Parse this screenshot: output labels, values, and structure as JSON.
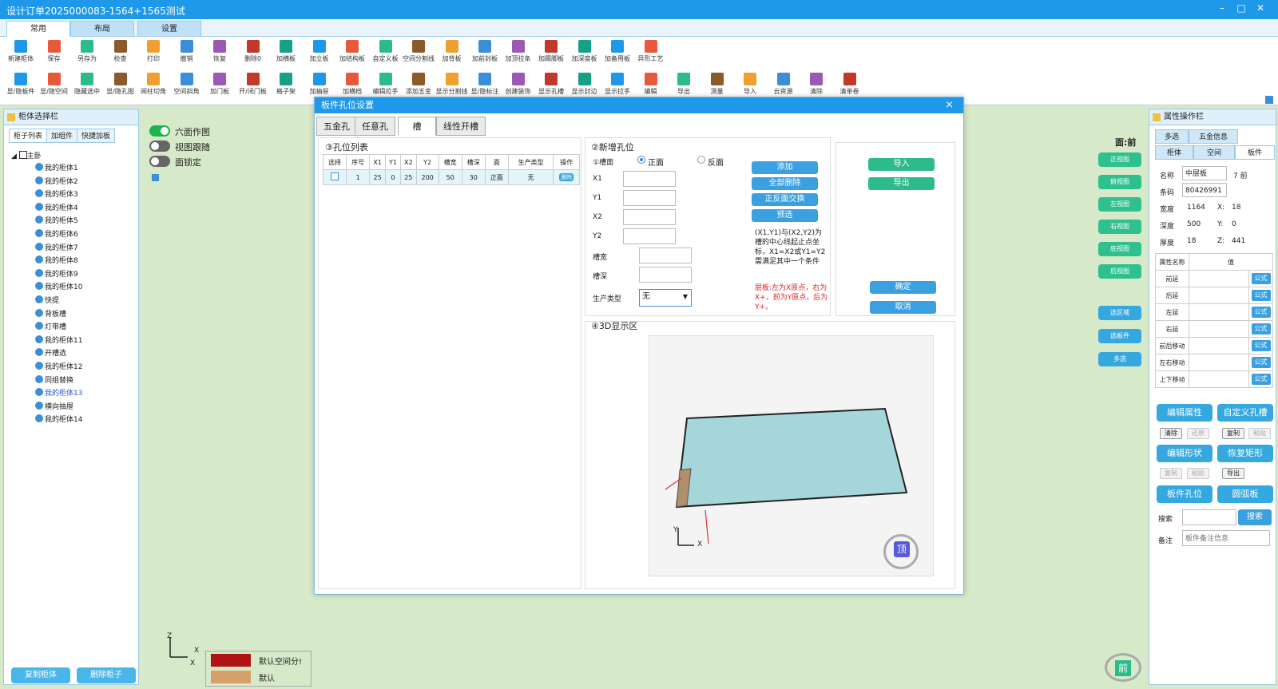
{
  "window": {
    "title": "设计订单2025000083-1564+1565测试"
  },
  "tabs": [
    "常用",
    "布局",
    "设置"
  ],
  "ribbon_row1": [
    "新建柜体",
    "保存",
    "另存为",
    "检查",
    "打印",
    "撤销",
    "恢复",
    "删除0",
    "加横板",
    "加立板",
    "加结构板",
    "自定义板",
    "空间分割线",
    "加背板",
    "加前封板",
    "加顶拉条",
    "加踢脚板",
    "加深度板",
    "加备用板",
    "异形工艺"
  ],
  "ribbon_row2": [
    "显/隐板件",
    "显/隐空间",
    "隐藏选中",
    "显/隐孔图",
    "阅柱切角",
    "空间斜角",
    "加门板",
    "开/闭门板",
    "格子架",
    "加抽屉",
    "加横档",
    "编辑拉手",
    "添加五金",
    "显示分割线",
    "显/隐标注",
    "创建装饰",
    "显示孔槽",
    "显示封边",
    "显示拉手",
    "编辑",
    "导出",
    "测量",
    "导入",
    "云资源",
    "清除",
    "清单卷"
  ],
  "left_panel": {
    "title": "柜体选择栏",
    "tabs": [
      "柜子列表",
      "加组件",
      "快捷加板"
    ],
    "root": "主卧",
    "items": [
      "我的柜体1",
      "我的柜体2",
      "我的柜体3",
      "我的柜体4",
      "我的柜体5",
      "我的柜体6",
      "我的柜体7",
      "我的柜体8",
      "我的柜体9",
      "我的柜体10",
      "快提",
      "背板槽",
      "灯带槽",
      "我的柜体11",
      "开槽选",
      "我的柜体12",
      "同组替换",
      "我的柜体13",
      "横向抽屉",
      "我的柜体14"
    ],
    "copy_btn": "复制柜体",
    "delete_btn": "删除柜子"
  },
  "toggles": [
    {
      "label": "六面作图",
      "on": true
    },
    {
      "label": "视图跟随",
      "on": false
    },
    {
      "label": "面锁定",
      "on": false
    }
  ],
  "view": {
    "face_label": "面:前",
    "buttons": [
      "正视图",
      "俯视图",
      "左视图",
      "右视图",
      "底视图",
      "后视图"
    ],
    "select_buttons": [
      "选区域",
      "选板件",
      "多选"
    ],
    "legend": [
      {
        "label": "默认空间分!",
        "color": "#b01414"
      },
      {
        "label": "默认",
        "color": "#d6a06a"
      }
    ],
    "axis_x": "X",
    "axis_z": "Z",
    "front_badge": "前"
  },
  "dialog": {
    "title": "板件孔位设置",
    "close": "×",
    "tabs": [
      "五金孔",
      "任意孔",
      "槽",
      "线性开槽"
    ],
    "list_title": "③孔位列表",
    "table_headers": [
      "选择",
      "序号",
      "X1",
      "Y1",
      "X2",
      "Y2",
      "槽宽",
      "槽深",
      "面",
      "生产类型",
      "操作"
    ],
    "table_rows": [
      [
        "1",
        "25",
        "0",
        "25",
        "200",
        "50",
        "30",
        "正面",
        "无",
        "删除"
      ]
    ],
    "add_title": "②新增孔位",
    "groove_label": "①槽面",
    "face_front": "正面",
    "face_back": "反面",
    "fields": [
      "X1",
      "Y1",
      "X2",
      "Y2",
      "槽宽",
      "槽深",
      "生产类型"
    ],
    "production_type": "无",
    "btn_add": "添加",
    "btn_delete_all": "全部删除",
    "btn_swap": "正反面交换",
    "btn_preview": "预选",
    "note": "(X1,Y1)与(X2,Y2)为槽的中心线起止点坐标，X1=X2或Y1=Y2需满足其中一个条件",
    "note_red": "层板:左为X原点，右为X+，前为Y原点，后为Y+。",
    "btn_import": "导入",
    "btn_export": "导出",
    "btn_ok": "确定",
    "btn_cancel": "取消",
    "display_title": "④3D显示区",
    "axis_x": "X",
    "axis_y": "Y",
    "top_badge": "顶"
  },
  "right_panel": {
    "title": "属性操作栏",
    "tabs_row1": [
      "多选",
      "五金信息"
    ],
    "tabs_row2": [
      "柜体",
      "空间",
      "板件"
    ],
    "name_label": "名称",
    "name_value": "中层板",
    "name_extra": "7 前",
    "code_label": "条码",
    "code_value": "80426991",
    "width_label": "宽度",
    "width_value": "1164",
    "x_label": "X:",
    "x_value": "18",
    "depth_label": "深度",
    "depth_value": "500",
    "y_label": "Y:",
    "y_value": "0",
    "thick_label": "厚度",
    "thick_value": "18",
    "z_label": "Z:",
    "z_value": "441",
    "prop_header": [
      "属性名称",
      "值"
    ],
    "props": [
      "前延",
      "后延",
      "左延",
      "右延",
      "前后移动",
      "左右移动",
      "上下移动"
    ],
    "formula": "公式",
    "btn_edit_attr": "编辑属性",
    "btn_custom_hole": "自定义孔槽",
    "small1": [
      "清除",
      "还原",
      "复制",
      "粘贴"
    ],
    "btn_edit_shape": "编辑形状",
    "btn_restore_rect": "恢复矩形",
    "small2": [
      "复制",
      "粘贴",
      "导出"
    ],
    "btn_board_hole": "板件孔位",
    "btn_arc_board": "圆弧板",
    "search_label": "搜索",
    "search_btn": "搜索",
    "remark_label": "备注",
    "remark_placeholder": "板件备注信息"
  }
}
